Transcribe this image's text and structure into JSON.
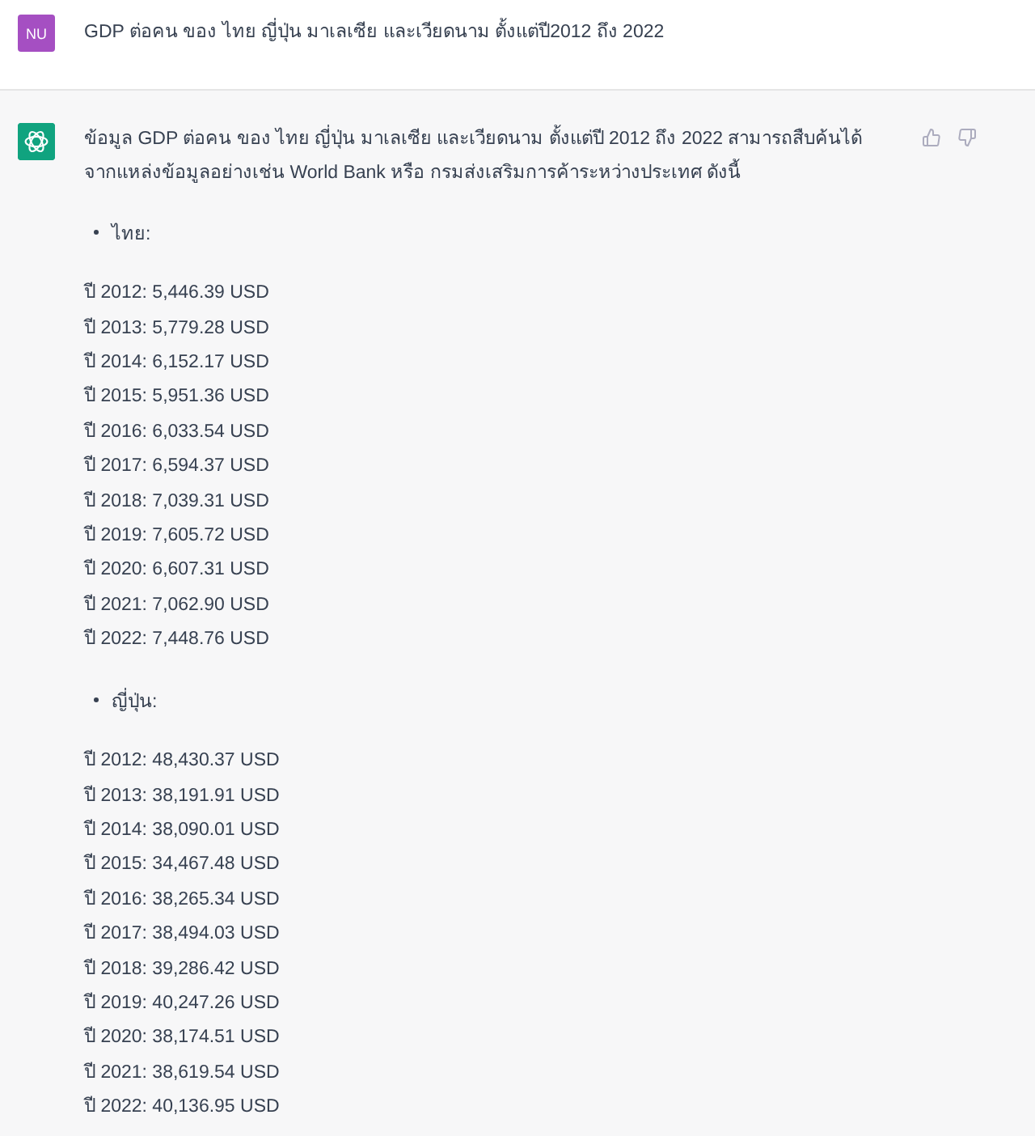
{
  "user_message": {
    "avatar": "NU",
    "text": "GDP ต่อคน ของ ไทย ญี่ปุ่น มาเลเซีย และเวียดนาม ตั้งแต่ปี2012 ถึง 2022"
  },
  "assistant_message": {
    "intro": "ข้อมูล GDP ต่อคน ของ ไทย ญี่ปุ่น มาเลเซีย และเวียดนาม ตั้งแต่ปี 2012 ถึง 2022 สามารถสืบค้นได้จากแหล่งข้อมูลอย่างเช่น World Bank หรือ กรมส่งเสริมการค้าระหว่างประเทศ ดังนี้",
    "sections": [
      {
        "heading": "ไทย:",
        "lines": [
          "ปี 2012: 5,446.39 USD",
          "ปี 2013: 5,779.28 USD",
          "ปี 2014: 6,152.17 USD",
          "ปี 2015: 5,951.36 USD",
          "ปี 2016: 6,033.54 USD",
          "ปี 2017: 6,594.37 USD",
          "ปี 2018: 7,039.31 USD",
          "ปี 2019: 7,605.72 USD",
          "ปี 2020: 6,607.31 USD",
          "ปี 2021: 7,062.90 USD",
          "ปี 2022: 7,448.76 USD"
        ]
      },
      {
        "heading": "ญี่ปุ่น:",
        "lines": [
          "ปี 2012: 48,430.37 USD",
          "ปี 2013: 38,191.91 USD",
          "ปี 2014: 38,090.01 USD",
          "ปี 2015: 34,467.48 USD",
          "ปี 2016: 38,265.34 USD",
          "ปี 2017: 38,494.03 USD",
          "ปี 2018: 39,286.42 USD",
          "ปี 2019: 40,247.26 USD",
          "ปี 2020: 38,174.51 USD",
          "ปี 2021: 38,619.54 USD",
          "ปี 2022: 40,136.95 USD"
        ]
      }
    ]
  }
}
